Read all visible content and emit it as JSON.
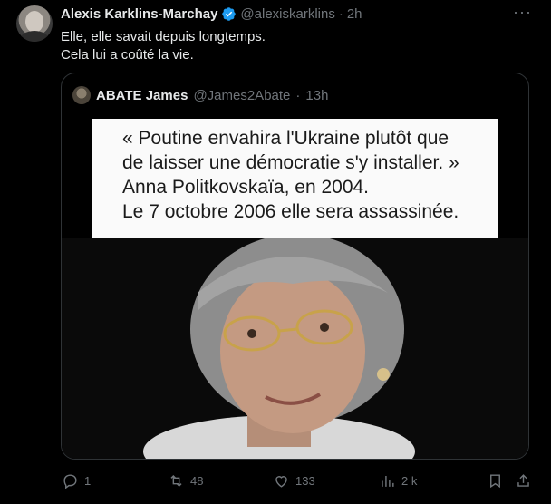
{
  "tweet": {
    "author_name": "Alexis Karklins-Marchay",
    "handle": "@alexiskarklins",
    "separator": "·",
    "time": "2h",
    "text_line1": "Elle, elle savait depuis longtemps.",
    "text_line2": "Cela lui a coûté la vie."
  },
  "quote": {
    "author_name": "ABATE James",
    "handle": "@James2Abate",
    "separator": "·",
    "time": "13h",
    "card_lines": [
      "« Poutine envahira l'Ukraine plutôt que",
      "de laisser une démocratie s'y installer. »",
      "Anna Politkovskaïa, en 2004.",
      "Le 7 octobre 2006 elle sera assassinée."
    ]
  },
  "actions": {
    "replies": "1",
    "reposts": "48",
    "likes": "133",
    "views": "2 k"
  },
  "colors": {
    "background": "#000000",
    "text": "#e7e9ea",
    "muted": "#71767b",
    "border": "#2f3336",
    "verified": "#1d9bf0"
  }
}
